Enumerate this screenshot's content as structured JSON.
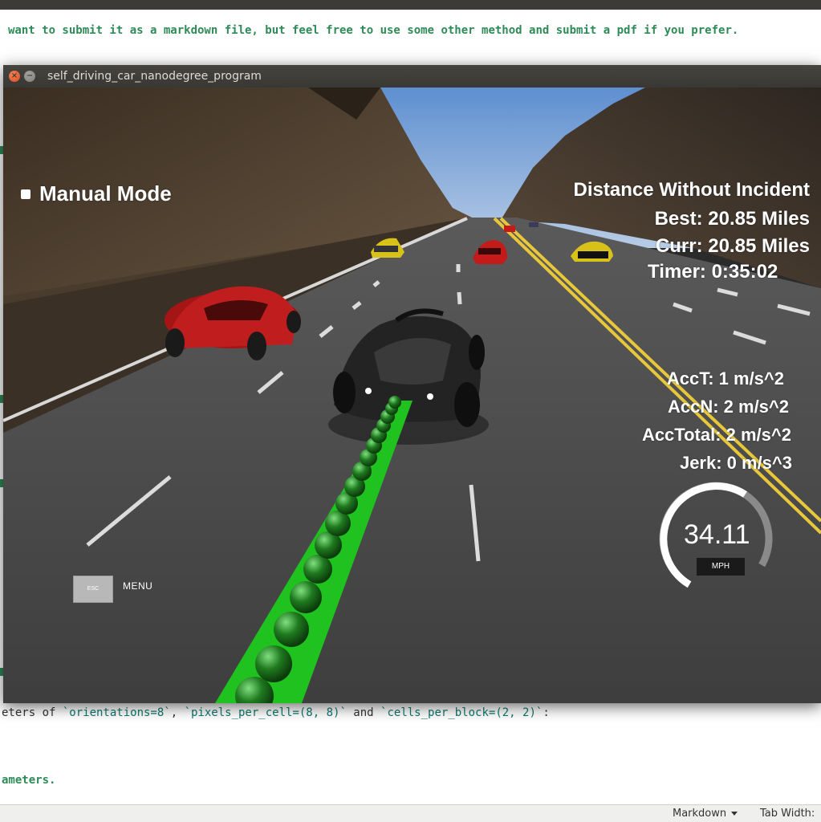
{
  "editor": {
    "top_line": "want to submit it as a markdown file, but feel free to use some other method and submit a pdf if you prefer.",
    "params_line": {
      "prefix": "eters of ",
      "code1": "`orientations=8`",
      "sep1": ", ",
      "code2": "`pixels_per_cell=(8, 8)`",
      "sep2": " and ",
      "code3": "`cells_per_block=(2, 2)`",
      "suffix": ":"
    },
    "bottom_line": "ameters."
  },
  "statusbar": {
    "mode": "Markdown",
    "tab_width": "Tab Width:"
  },
  "window": {
    "title": "self_driving_car_nanodegree_program",
    "close_glyph": "×",
    "min_glyph": "−"
  },
  "hud": {
    "mode": "Manual Mode",
    "distance_title": "Distance Without Incident",
    "best": "Best: 20.85 Miles",
    "curr": "Curr: 20.85 Miles",
    "timer": "Timer: 0:35:02",
    "acc_t": "AccT: 1 m/s^2",
    "acc_n": "AccN: 2 m/s^2",
    "acc_total": "AccTotal: 2 m/s^2",
    "jerk": "Jerk: 0 m/s^3",
    "esc_key": "ESC",
    "menu": "MENU",
    "speed": "34.11",
    "speed_unit": "MPH",
    "speed_gauge_fraction": 0.68
  },
  "colors": {
    "path_green": "#1fc21f",
    "sky": "#86aedc",
    "road": "#4a4a4a",
    "lane_yellow": "#e8c83a",
    "editor_green": "#2e8b57"
  },
  "icons": {
    "close": "close-icon",
    "minimize": "minimize-icon",
    "dropdown": "chevron-down-icon"
  }
}
